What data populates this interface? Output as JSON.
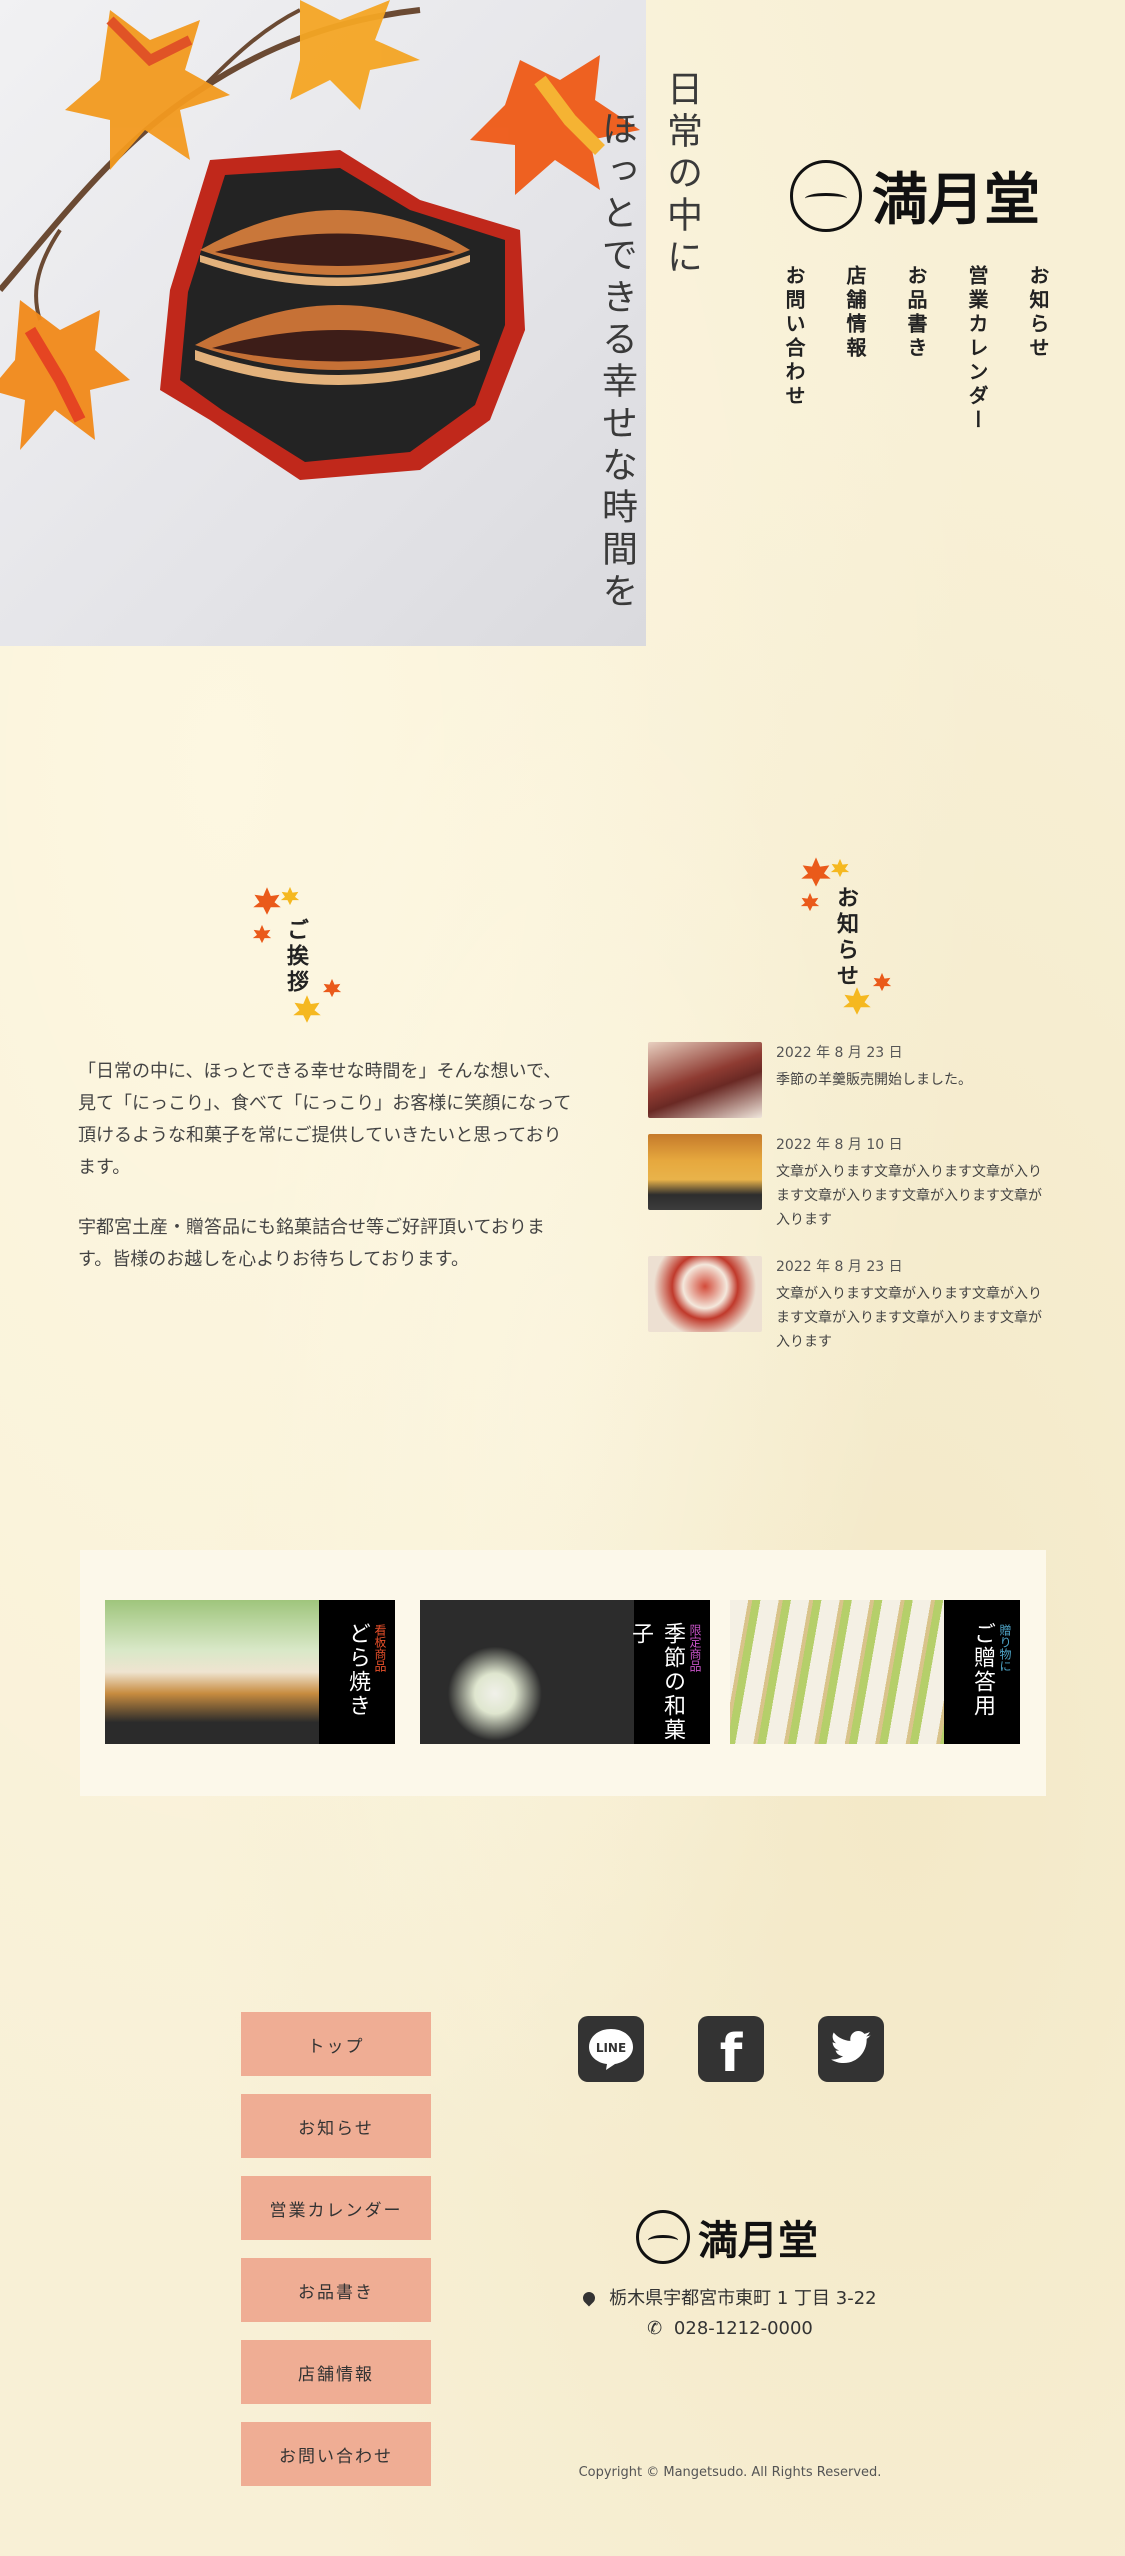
{
  "hero": {
    "tagline_1": "日常の中に",
    "tagline_2": "ほっとできる幸せな時間を"
  },
  "brand": {
    "name": "満月堂"
  },
  "nav": {
    "items": [
      {
        "label": "お知らせ"
      },
      {
        "label": "営業カレンダー"
      },
      {
        "label": "お品書き"
      },
      {
        "label": "店舗情報"
      },
      {
        "label": "お問い合わせ"
      }
    ]
  },
  "greeting": {
    "heading": "ご挨拶",
    "para1": "「日常の中に、ほっとできる幸せな時間を」そんな想いで、見て「にっこり」、食べて「にっこり」お客様に笑顔になって頂けるような和菓子を常にご提供していきたいと思っております。",
    "para2": "宇都宮土産・贈答品にも銘菓詰合せ等ご好評頂いております。皆様のお越しを心よりお待ちしております。"
  },
  "news": {
    "heading": "お知らせ",
    "items": [
      {
        "date": "2022 年 8 月 23 日",
        "text": "季節の羊羹販売開始しました。"
      },
      {
        "date": "2022 年 8 月 10 日",
        "text": "文章が入ります文章が入ります文章が入ります文章が入ります文章が入ります文章が入ります"
      },
      {
        "date": "2022 年 8 月 23 日",
        "text": "文章が入ります文章が入ります文章が入ります文章が入ります文章が入ります文章が入ります"
      }
    ]
  },
  "products": {
    "cards": [
      {
        "title": "どら焼き",
        "tag": "看板商品",
        "tag_color": "#e8502a"
      },
      {
        "title": "季節の和菓子",
        "tag": "限定商品",
        "tag_color": "#c653c6"
      },
      {
        "title": "ご贈答用",
        "tag": "贈り物に",
        "tag_color": "#4fa6c9"
      }
    ]
  },
  "footer": {
    "nav": [
      {
        "label": "トップ"
      },
      {
        "label": "お知らせ"
      },
      {
        "label": "営業カレンダー"
      },
      {
        "label": "お品書き"
      },
      {
        "label": "店舗情報"
      },
      {
        "label": "お問い合わせ"
      }
    ],
    "social": [
      {
        "icon": "line-icon",
        "label": "LINE"
      },
      {
        "icon": "facebook-icon",
        "label": "f"
      },
      {
        "icon": "twitter-icon",
        "label": ""
      }
    ],
    "address": "栃木県宇都宮市東町 1 丁目 3-22",
    "phone": "028-1212-0000",
    "copyright": "Copyright © Mangetsudo. All Rights Reserved."
  },
  "colors": {
    "background": "#f8f0d6",
    "button": "#efad94",
    "card_label": "#000000",
    "icon": "#333333"
  }
}
